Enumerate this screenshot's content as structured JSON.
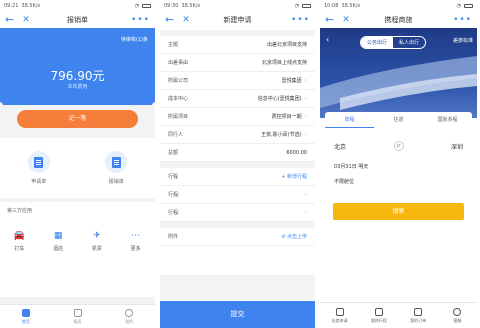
{
  "phone1": {
    "status_time": "09:21",
    "status_net": "38.5K/s",
    "title": "报销单",
    "detail_link": "待审核(1)条",
    "amount": "796.90元",
    "amount_label": "本年费用",
    "record_button": "记一笔",
    "apply_items": [
      {
        "label": "申请单",
        "icon": "apply-form-icon"
      },
      {
        "label": "报销单",
        "icon": "expense-form-icon"
      }
    ],
    "third_title": "第三方应用",
    "third_items": [
      {
        "label": "打车",
        "glyph": "🚘"
      },
      {
        "label": "酒店",
        "glyph": "▦"
      },
      {
        "label": "机票",
        "glyph": "✈"
      },
      {
        "label": "更多",
        "glyph": "⋯"
      }
    ],
    "tabs": [
      {
        "label": "首页",
        "active": true
      },
      {
        "label": "报表",
        "active": false
      },
      {
        "label": "我的",
        "active": false
      }
    ]
  },
  "phone2": {
    "status_time": "09:30",
    "status_net": "38.5K/s",
    "title": "新建申请",
    "rows_top": [
      {
        "label": "主题",
        "value": "出差北京项目支持"
      },
      {
        "label": "出差事由",
        "value": "北京项目上线点支持"
      },
      {
        "label": "所属公司",
        "value": "壹悦集团"
      },
      {
        "label": "成本中心",
        "value": "信息中心(壹悦集团)"
      },
      {
        "label": "所属项目",
        "value": "费控项目一期"
      },
      {
        "label": "同行人",
        "value": "王依,陈小凤(节选)"
      },
      {
        "label": "总额",
        "value": "6000.00"
      }
    ],
    "itinerary_label": "行程",
    "add_itinerary": "+ 新增行程",
    "itinerary_rows": [
      "行程:",
      "行程:"
    ],
    "attachment_label": "附件",
    "upload_label": "点击上传",
    "submit": "提交"
  },
  "phone3": {
    "status_time": "10:08",
    "status_net": "38.5K/s",
    "title": "携程商旅",
    "segment": [
      "公务出行",
      "私人出行"
    ],
    "policy": "差旅标准",
    "trip_tabs": [
      "单程",
      "往返",
      "国际多程"
    ],
    "from_city": "北京",
    "to_city": "深圳",
    "date": "03月31日 明天",
    "cabin": "不限舱位",
    "search": "搜索",
    "tabs": [
      "出差申请",
      "我的行程",
      "我的订单",
      "客服"
    ]
  }
}
